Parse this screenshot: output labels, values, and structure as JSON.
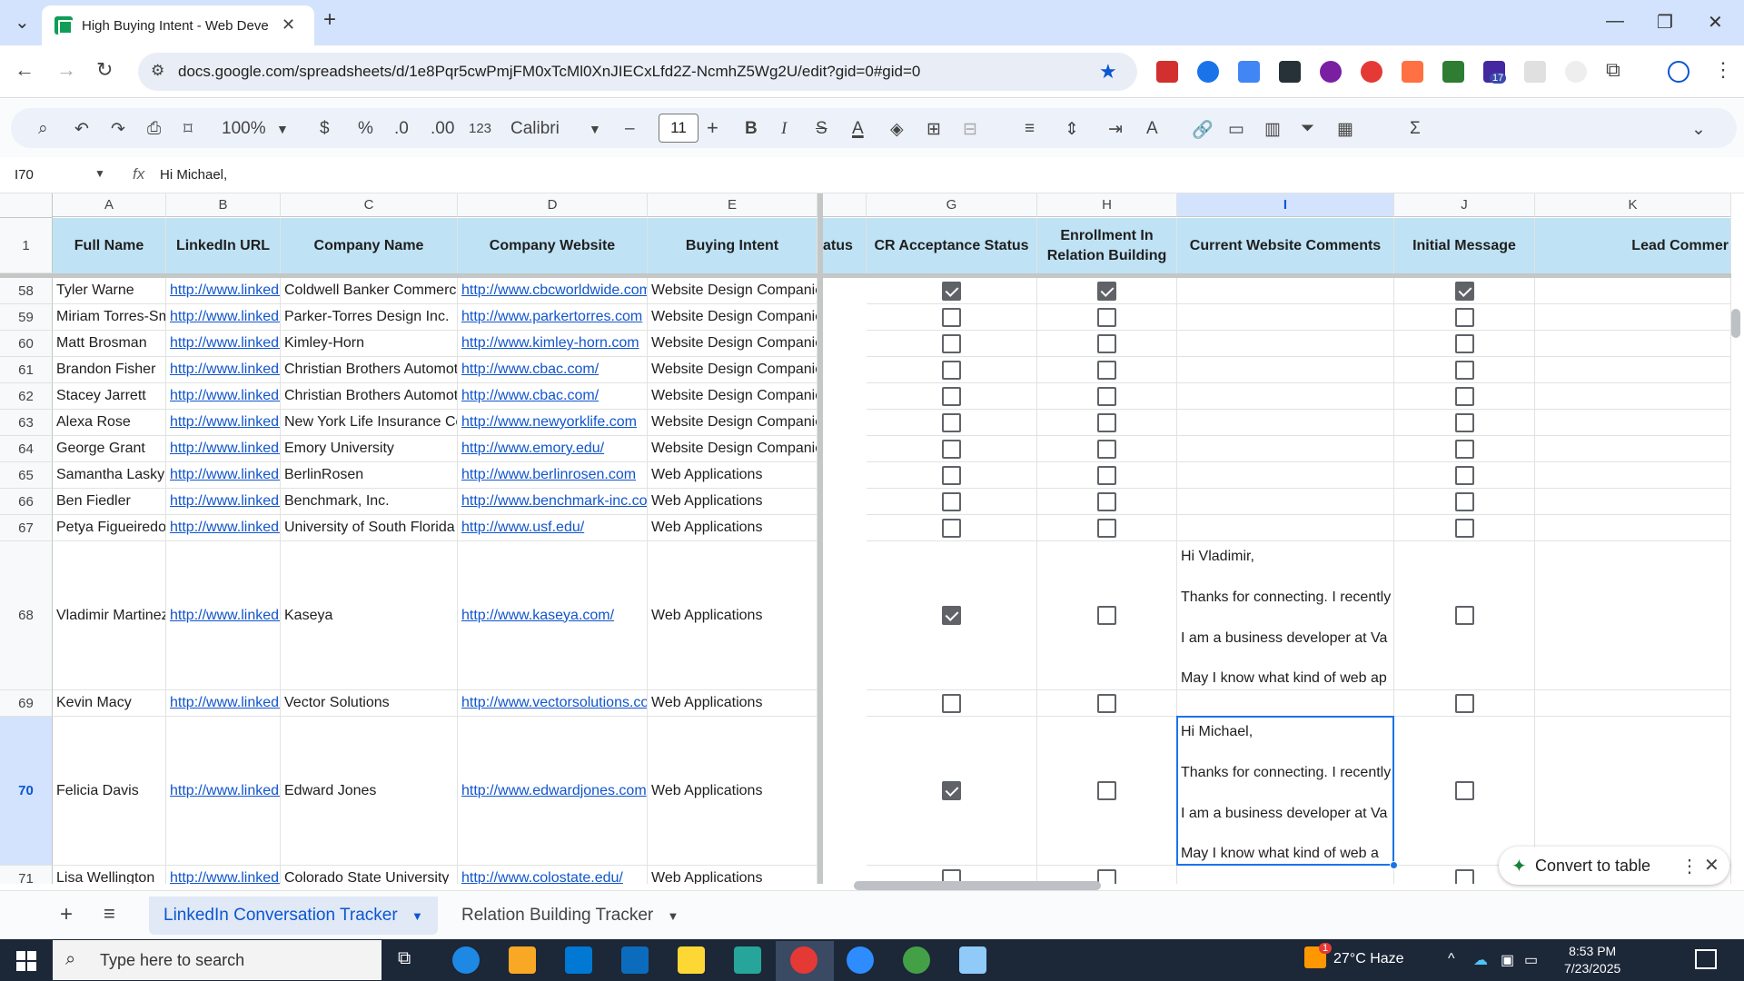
{
  "browser": {
    "tab_title": "High Buying Intent - Web Deve",
    "url": "docs.google.com/spreadsheets/d/1e8Pqr5cwPmjFM0xTcMl0XnJIECxLfd2Z-NcmhZ5Wg2U/edit?gid=0#gid=0"
  },
  "toolbar": {
    "zoom": "100%",
    "currency": "$",
    "percent": "%",
    "dec_dec": ".0",
    "dec_inc": ".00",
    "number_format": "123",
    "font": "Calibri",
    "font_size": "11",
    "bold": "B",
    "italic": "I",
    "strike": "S",
    "text_color": "A",
    "sum": "Σ"
  },
  "formula_bar": {
    "name_box": "I70",
    "fx": "fx",
    "content": "Hi Michael,"
  },
  "columns": [
    "A",
    "B",
    "C",
    "D",
    "E",
    "G",
    "H",
    "I",
    "J",
    "K"
  ],
  "headers": {
    "A": "Full Name",
    "B": "LinkedIn URL",
    "C": "Company Name",
    "D": "Company Website",
    "E": "Buying Intent",
    "F": "atus",
    "G": "CR Acceptance Status",
    "H": "Enrollment In Relation Building",
    "I": "Current Website Comments",
    "J": "Initial Message",
    "K": "Lead Commer"
  },
  "header_row_number": "1",
  "rows": [
    {
      "num": "58",
      "name": "Tyler Warne",
      "linkedin": "http://www.linkedin.com",
      "company": "Coldwell Banker Commercial",
      "website": "http://www.cbcworldwide.com",
      "intent": "Website Design Companies",
      "g": true,
      "h": true,
      "i": "",
      "j": true
    },
    {
      "num": "59",
      "name": "Miriam Torres-Smith",
      "linkedin": "http://www.linkedin.com",
      "company": "Parker-Torres Design Inc.",
      "website": "http://www.parkertorres.com",
      "intent": "Website Design Companies",
      "g": false,
      "h": false,
      "i": "",
      "j": false
    },
    {
      "num": "60",
      "name": "Matt Brosman",
      "linkedin": "http://www.linkedin.com",
      "company": "Kimley-Horn",
      "website": "http://www.kimley-horn.com",
      "intent": "Website Design Companies",
      "g": false,
      "h": false,
      "i": "",
      "j": false
    },
    {
      "num": "61",
      "name": "Brandon Fisher",
      "linkedin": "http://www.linkedin.com",
      "company": "Christian Brothers Automotive",
      "website": "http://www.cbac.com/",
      "intent": "Website Design Companies",
      "g": false,
      "h": false,
      "i": "",
      "j": false
    },
    {
      "num": "62",
      "name": "Stacey Jarrett",
      "linkedin": "http://www.linkedin.com",
      "company": "Christian Brothers Automotive",
      "website": "http://www.cbac.com/",
      "intent": "Website Design Companies",
      "g": false,
      "h": false,
      "i": "",
      "j": false
    },
    {
      "num": "63",
      "name": "Alexa Rose",
      "linkedin": "http://www.linkedin.com",
      "company": "New York Life Insurance Company",
      "website": "http://www.newyorklife.com",
      "intent": "Website Design Companies",
      "g": false,
      "h": false,
      "i": "",
      "j": false
    },
    {
      "num": "64",
      "name": "George Grant",
      "linkedin": "http://www.linkedin.com",
      "company": "Emory University",
      "website": "http://www.emory.edu/",
      "intent": "Website Design Companies",
      "g": false,
      "h": false,
      "i": "",
      "j": false
    },
    {
      "num": "65",
      "name": "Samantha Lasky",
      "linkedin": "http://www.linkedin.com",
      "company": "BerlinRosen",
      "website": "http://www.berlinrosen.com",
      "intent": "Web Applications",
      "g": false,
      "h": false,
      "i": "",
      "j": false
    },
    {
      "num": "66",
      "name": "Ben Fiedler",
      "linkedin": "http://www.linkedin.com",
      "company": "Benchmark, Inc.",
      "website": "http://www.benchmark-inc.com",
      "intent": "Web Applications",
      "g": false,
      "h": false,
      "i": "",
      "j": false
    },
    {
      "num": "67",
      "name": "Petya Figueiredo",
      "linkedin": "http://www.linkedin.com",
      "company": "University of South Florida",
      "website": "http://www.usf.edu/",
      "intent": "Web Applications",
      "g": false,
      "h": false,
      "i": "",
      "j": false
    },
    {
      "num": "68",
      "name": "Vladimir Martinez",
      "linkedin": "http://www.linkedin.com",
      "company": "Kaseya",
      "website": "http://www.kaseya.com/",
      "intent": "Web Applications",
      "g": true,
      "h": false,
      "i": "Hi Vladimir,\n\nThanks for connecting. I recently\n\nI am a business developer at Va\n\nMay I know what kind of web ap",
      "j": false
    },
    {
      "num": "69",
      "name": "Kevin Macy",
      "linkedin": "http://www.linkedin.com",
      "company": "Vector Solutions",
      "website": "http://www.vectorsolutions.com",
      "intent": "Web Applications",
      "g": false,
      "h": false,
      "i": "",
      "j": false
    },
    {
      "num": "70",
      "name": "Felicia Davis",
      "linkedin": "http://www.linkedin.com",
      "company": "Edward Jones",
      "website": "http://www.edwardjones.com",
      "intent": "Web Applications",
      "g": true,
      "h": false,
      "i": "Hi Michael,\n\nThanks for connecting. I recently\n\nI am a business developer at Va\n\nMay I know what kind of web a",
      "j": false
    },
    {
      "num": "71",
      "name": "Lisa Wellington",
      "linkedin": "http://www.linkedin.com",
      "company": "Colorado State University",
      "website": "http://www.colostate.edu/",
      "intent": "Web Applications",
      "g": false,
      "h": false,
      "i": "",
      "j": false
    }
  ],
  "convert_chip": {
    "label": "Convert to table"
  },
  "sheet_tabs": [
    {
      "label": "LinkedIn Conversation Tracker",
      "active": true
    },
    {
      "label": "Relation Building Tracker",
      "active": false
    }
  ],
  "taskbar": {
    "search_placeholder": "Type here to search",
    "weather": "27°C Haze",
    "time": "8:53 PM",
    "date": "7/23/2025",
    "notification_badge": "1"
  },
  "extension_badge": "17",
  "colors": {
    "header_fill": "#bfe2f4",
    "link": "#1155cc",
    "selection": "#1a73e8",
    "tabstrip": "#d3e3fd",
    "taskbar": "#1c2738"
  }
}
